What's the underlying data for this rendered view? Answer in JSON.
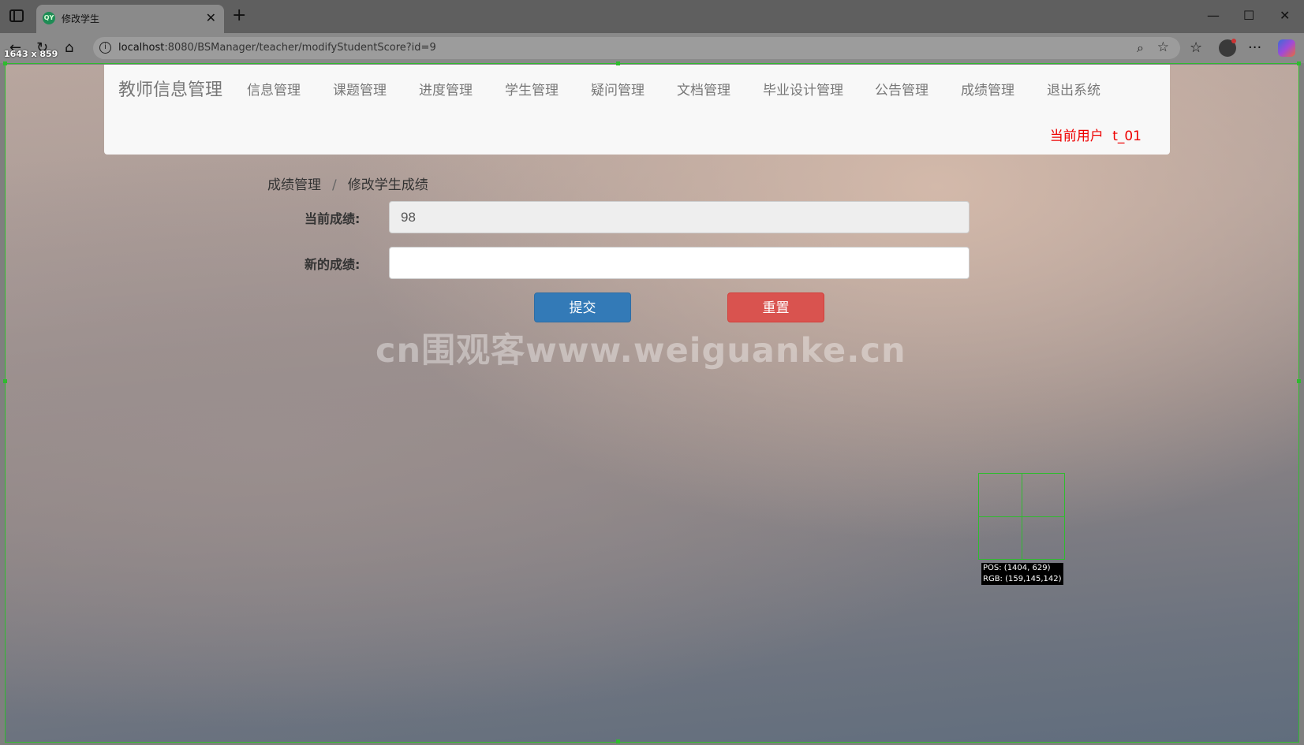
{
  "browser": {
    "tab_title": "修改学生",
    "tab_icon_text": "QY",
    "url_host": "localhost",
    "url_rest": ":8080/BSManager/teacher/modifyStudentScore?id=9"
  },
  "capture": {
    "size_label": "1643 x 859",
    "pos_label": "POS:  (1404, 629)",
    "rgb_label": "RGB:  (159,145,142)"
  },
  "navbar": {
    "brand": "教师信息管理",
    "items": [
      "信息管理",
      "课题管理",
      "进度管理",
      "学生管理",
      "疑问管理",
      "文档管理",
      "毕业设计管理",
      "公告管理",
      "成绩管理",
      "退出系统"
    ],
    "current_user": "当前用户 t_01"
  },
  "breadcrumb": {
    "parent": "成绩管理",
    "separator": "/",
    "current": "修改学生成绩"
  },
  "form": {
    "current_label": "当前成绩:",
    "current_value": "98",
    "new_label": "新的成绩:",
    "new_value": "",
    "submit_label": "提交",
    "reset_label": "重置"
  },
  "watermark": "cn围观客www.weiguanke.cn"
}
